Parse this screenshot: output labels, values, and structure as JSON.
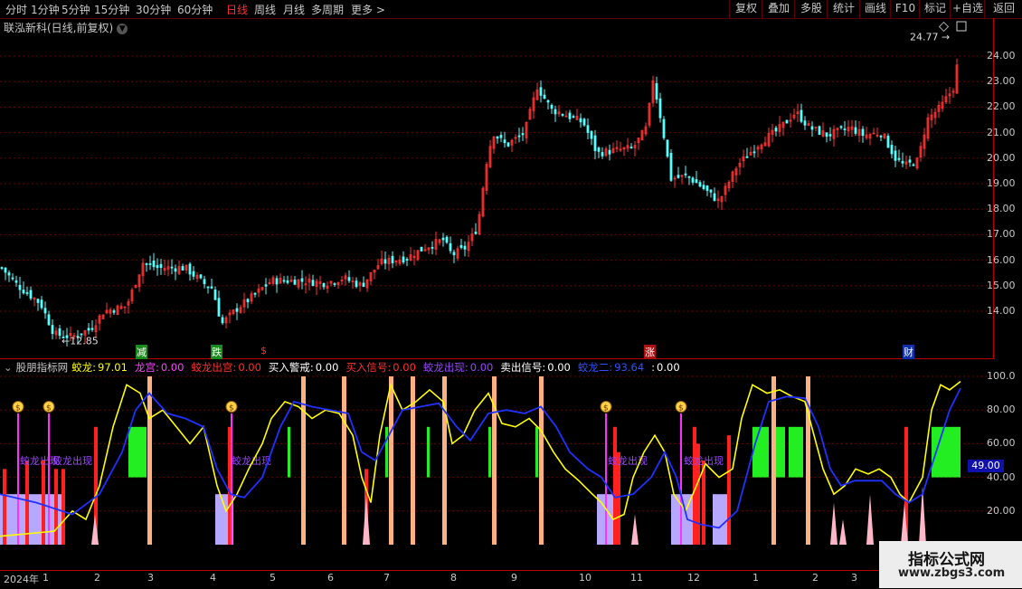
{
  "toolbar": {
    "periods": [
      "分时",
      "1分钟",
      "5分钟",
      "15分钟",
      "30分钟",
      "60分钟",
      "日线",
      "周线",
      "月线",
      "多周期",
      "更多 >"
    ],
    "active_period": "日线",
    "right_buttons": [
      "复权",
      "叠加",
      "多股",
      "统计",
      "画线",
      "F10",
      "标记",
      "+自选",
      "返回"
    ]
  },
  "main_chart": {
    "title": "联泓新科(日线,前复权)",
    "price_ticks": [
      "24.00",
      "23.00",
      "22.00",
      "21.00",
      "20.00",
      "19.00",
      "18.00",
      "17.00",
      "16.00",
      "15.00",
      "14.00"
    ],
    "high_label": "24.77",
    "low_label": "12.85",
    "event_markers": [
      {
        "text": "减",
        "bg": "#1a8a1a",
        "fg": "#ffffff"
      },
      {
        "text": "跌",
        "bg": "#1a8a1a",
        "fg": "#ffffff"
      },
      {
        "text": "$",
        "bg": "#000000",
        "fg": "#ff3030"
      },
      {
        "text": "涨",
        "bg": "#aa1010",
        "fg": "#ffffff"
      },
      {
        "text": "财",
        "bg": "#1030aa",
        "fg": "#ffffff"
      }
    ],
    "up_color": "#ff3232",
    "down_color": "#54ffff"
  },
  "indicator": {
    "source": "股朋指标网",
    "legend": [
      {
        "name": "蛟龙:",
        "value": "97.01",
        "color": "#ffff00"
      },
      {
        "name": "龙宫:",
        "value": "0.00",
        "color": "#ff44ff"
      },
      {
        "name": "蛟龙出宫:",
        "value": "0.00",
        "color": "#ff3030"
      },
      {
        "name": "买入警戒:",
        "value": "0.00",
        "color": "#ffffff"
      },
      {
        "name": "买入信号:",
        "value": "0.00",
        "color": "#ff3030"
      },
      {
        "name": "蛟龙出现:",
        "value": "0.00",
        "color": "#9a45ff"
      },
      {
        "name": "卖出信号:",
        "value": "0.00",
        "color": "#ffffff"
      },
      {
        "name": "蛟龙二:",
        "value": "93.64",
        "color": "#3050ff"
      },
      {
        "name": ":",
        "value": "0.00",
        "color": "#ffffff"
      }
    ],
    "axis_ticks": [
      "100.0",
      "80.00",
      "60.00",
      "40.00",
      "20.00"
    ],
    "current_value": "49.00",
    "signal_label": "蛟龙出现",
    "money_icon_count": 5
  },
  "date_axis": [
    "2024年",
    "1",
    "2",
    "3",
    "4",
    "5",
    "6",
    "7",
    "8",
    "9",
    "10",
    "11",
    "12",
    "1",
    "2",
    "3"
  ],
  "watermark": {
    "line1": "指标公式网",
    "line2": "www.zbgs3.com"
  }
}
